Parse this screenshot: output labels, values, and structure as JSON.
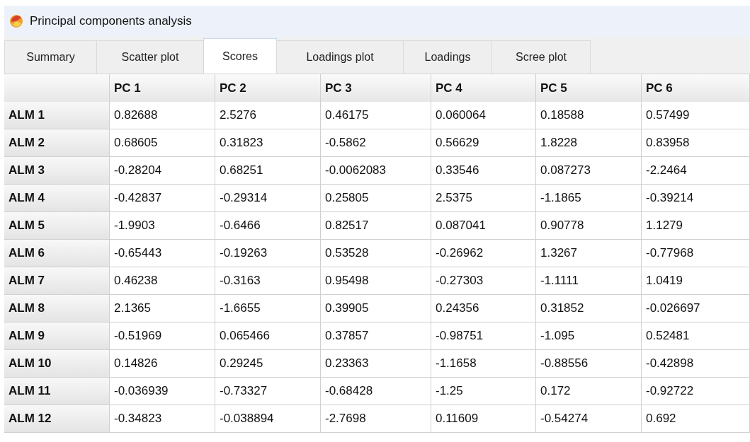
{
  "window": {
    "title": "Principal components analysis"
  },
  "tabs": [
    {
      "label": "Summary",
      "selected": false
    },
    {
      "label": "Scatter plot",
      "selected": false
    },
    {
      "label": "Scores",
      "selected": true
    },
    {
      "label": "Loadings plot",
      "selected": false
    },
    {
      "label": "Loadings",
      "selected": false
    },
    {
      "label": "Scree plot",
      "selected": false
    }
  ],
  "table": {
    "columns": [
      "PC 1",
      "PC 2",
      "PC 3",
      "PC 4",
      "PC 5",
      "PC 6"
    ],
    "rows": [
      {
        "label": "ALM 1",
        "values": [
          "0.82688",
          "2.5276",
          "0.46175",
          "0.060064",
          "0.18588",
          "0.57499"
        ]
      },
      {
        "label": "ALM 2",
        "values": [
          "0.68605",
          "0.31823",
          "-0.5862",
          "0.56629",
          "1.8228",
          "0.83958"
        ]
      },
      {
        "label": "ALM 3",
        "values": [
          "-0.28204",
          "0.68251",
          "-0.0062083",
          "0.33546",
          "0.087273",
          "-2.2464"
        ]
      },
      {
        "label": "ALM 4",
        "values": [
          "-0.42837",
          "-0.29314",
          "0.25805",
          "2.5375",
          "-1.1865",
          "-0.39214"
        ]
      },
      {
        "label": "ALM 5",
        "values": [
          "-1.9903",
          "-0.6466",
          "0.82517",
          "0.087041",
          "0.90778",
          "1.1279"
        ]
      },
      {
        "label": "ALM 6",
        "values": [
          "-0.65443",
          "-0.19263",
          "0.53528",
          "-0.26962",
          "1.3267",
          "-0.77968"
        ]
      },
      {
        "label": "ALM 7",
        "values": [
          "0.46238",
          "-0.3163",
          "0.95498",
          "-0.27303",
          "-1.1111",
          "1.0419"
        ]
      },
      {
        "label": "ALM 8",
        "values": [
          "2.1365",
          "-1.6655",
          "0.39905",
          "0.24356",
          "0.31852",
          "-0.026697"
        ]
      },
      {
        "label": "ALM 9",
        "values": [
          "-0.51969",
          "0.065466",
          "0.37857",
          "-0.98751",
          "-1.095",
          "0.52481"
        ]
      },
      {
        "label": "ALM 10",
        "values": [
          "0.14826",
          "0.29245",
          "0.23363",
          "-1.1658",
          "-0.88556",
          "-0.42898"
        ]
      },
      {
        "label": "ALM 11",
        "values": [
          "-0.036939",
          "-0.73327",
          "-0.68428",
          "-1.25",
          "0.172",
          "-0.92722"
        ]
      },
      {
        "label": "ALM 12",
        "values": [
          "-0.34823",
          "-0.038894",
          "-2.7698",
          "0.11609",
          "-0.54274",
          "0.692"
        ]
      }
    ]
  }
}
